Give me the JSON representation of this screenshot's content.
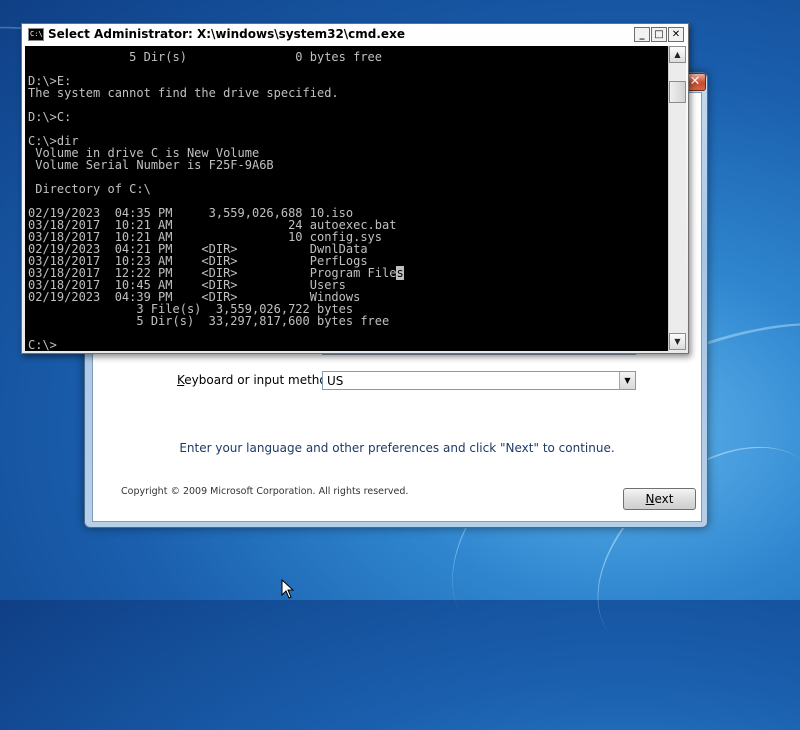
{
  "cmd": {
    "title": "Select Administrator: X:\\windows\\system32\\cmd.exe",
    "icon_label": "C:\\",
    "controls": {
      "minimize": "_",
      "maximize": "□",
      "close": "✕"
    },
    "lines": [
      "              5 Dir(s)               0 bytes free",
      "",
      "D:\\>E:",
      "The system cannot find the drive specified.",
      "",
      "D:\\>C:",
      "",
      "C:\\>dir",
      " Volume in drive C is New Volume",
      " Volume Serial Number is F25F-9A6B",
      "",
      " Directory of C:\\",
      "",
      "02/19/2023  04:35 PM     3,559,026,688 10.iso",
      "03/18/2017  10:21 AM                24 autoexec.bat",
      "03/18/2017  10:21 AM                10 config.sys",
      "02/19/2023  04:21 PM    <DIR>          DwnlData",
      "03/18/2017  10:23 AM    <DIR>          PerfLogs",
      "03/18/2017  12:22 PM    <DIR>          Program File",
      "03/18/2017  10:45 AM    <DIR>          Users",
      "02/19/2023  04:39 PM    <DIR>          Windows",
      "               3 File(s)  3,559,026,722 bytes",
      "               5 Dir(s)  33,297,817,600 bytes free",
      "",
      "C:\\>"
    ],
    "caret_line_index": 18,
    "caret_char": "s"
  },
  "setup": {
    "close_label": "✕",
    "keyboard_label": "Keyboard or input method:",
    "keyboard_value": "US",
    "hint": "Enter your language and other preferences and click \"Next\" to continue.",
    "copyright": "Copyright © 2009 Microsoft Corporation. All rights reserved.",
    "next_label": "Next"
  },
  "icons": {
    "cmd_app": "cmd-icon",
    "scroll_up": "triangle-up-icon",
    "scroll_down": "triangle-down-icon",
    "dropdown": "chevron-down-icon",
    "pointer": "mouse-pointer-icon"
  }
}
